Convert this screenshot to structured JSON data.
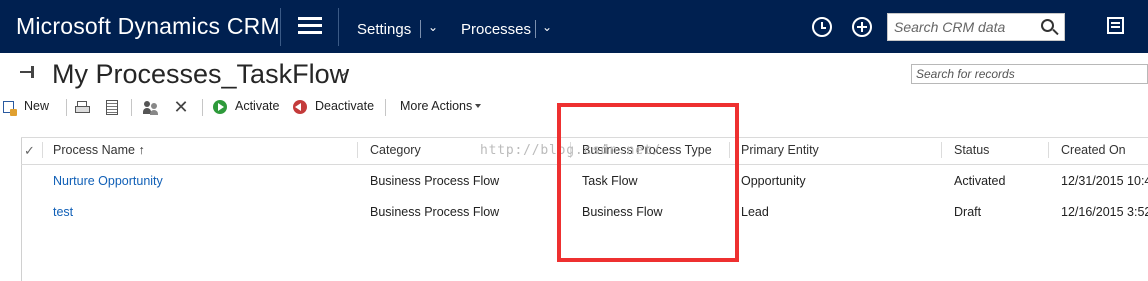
{
  "header": {
    "brand": "Microsoft Dynamics CRM",
    "nav_items": [
      {
        "label": "Settings"
      },
      {
        "label": "Processes"
      }
    ],
    "search_placeholder": "Search CRM data",
    "bar_color": "#002050"
  },
  "view": {
    "title": "My Processes_TaskFlow",
    "record_search_placeholder": "Search for records"
  },
  "commands": {
    "new": "New",
    "activate": "Activate",
    "deactivate": "Deactivate",
    "more_actions": "More Actions"
  },
  "grid": {
    "columns": [
      "Process Name ↑",
      "Category",
      "Business Process Type",
      "Primary Entity",
      "Status",
      "Created On"
    ],
    "rows": [
      {
        "process_name": "Nurture Opportunity",
        "category": "Business Process Flow",
        "business_process_type": "Task Flow",
        "primary_entity": "Opportunity",
        "status": "Activated",
        "created_on": "12/31/2015 10:4..."
      },
      {
        "process_name": "test",
        "category": "Business Process Flow",
        "business_process_type": "Business Flow",
        "primary_entity": "Lead",
        "status": "Draft",
        "created_on": "12/16/2015 3:52..."
      }
    ]
  },
  "annotation": {
    "color": "#ee3030"
  },
  "watermark": "http://blog.csdn.net/"
}
